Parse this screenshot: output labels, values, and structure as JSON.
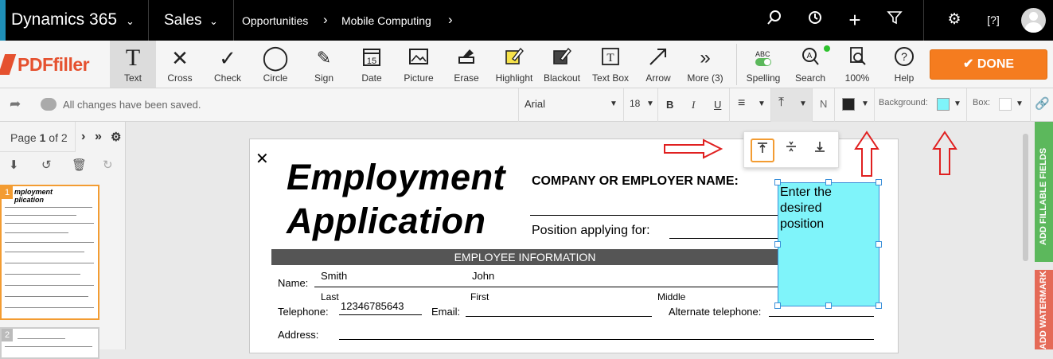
{
  "topnav": {
    "app_name": "Dynamics 365",
    "area": "Sales",
    "breadcrumb": [
      "Opportunities",
      "Mobile Computing"
    ]
  },
  "toolbar": {
    "logo": "PDFfiller",
    "tools": [
      {
        "label": "Text",
        "icon": "text-icon"
      },
      {
        "label": "Cross",
        "icon": "cross-icon"
      },
      {
        "label": "Check",
        "icon": "check-icon"
      },
      {
        "label": "Circle",
        "icon": "circle-icon"
      },
      {
        "label": "Sign",
        "icon": "sign-icon"
      },
      {
        "label": "Date",
        "icon": "date-icon"
      },
      {
        "label": "Picture",
        "icon": "picture-icon"
      },
      {
        "label": "Erase",
        "icon": "erase-icon"
      },
      {
        "label": "Highlight",
        "icon": "highlight-icon"
      },
      {
        "label": "Blackout",
        "icon": "blackout-icon"
      },
      {
        "label": "Text Box",
        "icon": "textbox-icon"
      },
      {
        "label": "Arrow",
        "icon": "arrow-icon"
      },
      {
        "label": "More (3)",
        "icon": "more-icon"
      }
    ],
    "right_tools": [
      {
        "label": "Spelling",
        "icon": "spelling-icon",
        "badge": "ABC"
      },
      {
        "label": "Search",
        "icon": "search-icon"
      },
      {
        "label": "100%",
        "icon": "zoom-icon"
      },
      {
        "label": "Help",
        "icon": "help-icon"
      }
    ],
    "done_label": "DONE"
  },
  "subbar": {
    "status": "All changes have been saved.",
    "font": "Arial",
    "font_size": "18",
    "bold": "B",
    "italic": "I",
    "underline": "U",
    "n_label": "N",
    "background_label": "Background:",
    "box_label": "Box:",
    "background_color": "#7ff4fa",
    "text_color": "#222222",
    "box_color": "#ffffff"
  },
  "leftpanel": {
    "page_label": "Page",
    "page_current": "1",
    "page_of": "of 2",
    "thumbs": [
      "1",
      "2"
    ]
  },
  "document": {
    "title_line1": "Employment",
    "title_line2": "Application",
    "company_label": "COMPANY OR EMPLOYER NAME:",
    "position_label": "Position applying for:",
    "section_header": "EMPLOYEE INFORMATION",
    "name_label": "Name:",
    "last_name": "Smith",
    "first_name": "John",
    "last_label": "Last",
    "first_label": "First",
    "middle_label": "Middle",
    "telephone_label": "Telephone:",
    "telephone_value": "12346785643",
    "email_label": "Email:",
    "alt_phone_label": "Alternate telephone:",
    "address_label": "Address:"
  },
  "textbox": {
    "line1": "Enter the",
    "line2": "desired",
    "line3": "position"
  },
  "rightstrip": {
    "fillable": "ADD FILLABLE FIELDS",
    "watermark": "ADD WATERMARK"
  },
  "colors": {
    "accent_orange": "#f57c1f",
    "annotation_red": "#e02020",
    "green_strip": "#5cb85c"
  }
}
